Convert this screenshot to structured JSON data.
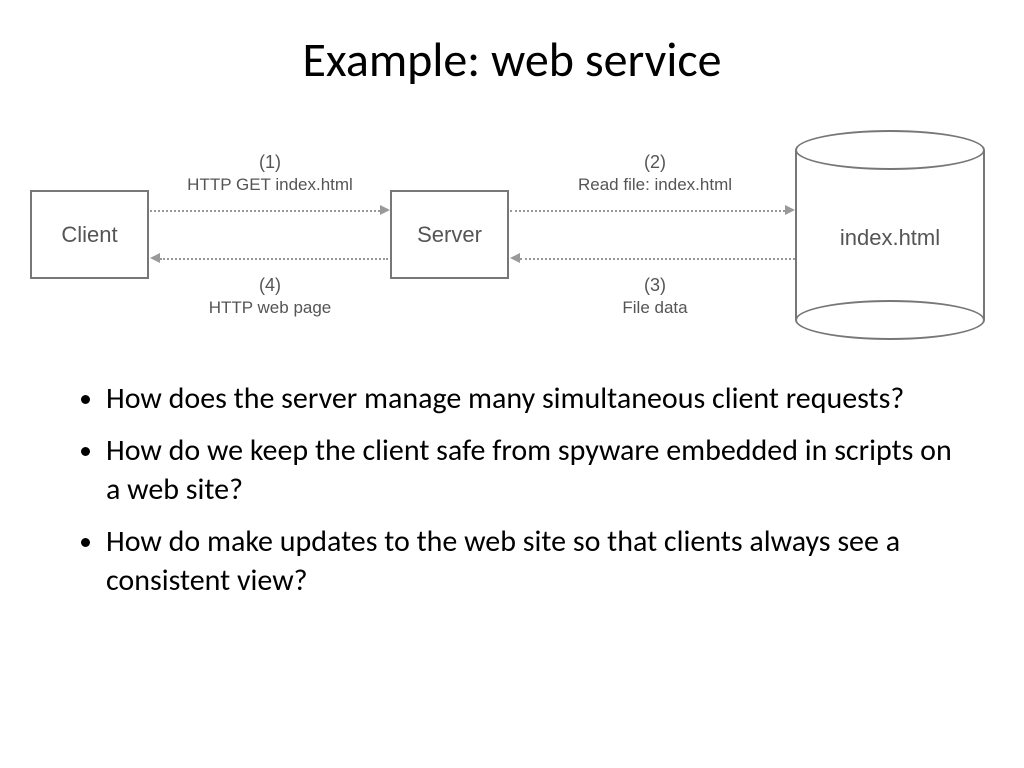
{
  "title": "Example: web service",
  "diagram": {
    "client_label": "Client",
    "server_label": "Server",
    "file_label": "index.html",
    "step1_num": "(1)",
    "step1_txt": "HTTP GET index.html",
    "step2_num": "(2)",
    "step2_txt": "Read file: index.html",
    "step3_num": "(3)",
    "step3_txt": "File data",
    "step4_num": "(4)",
    "step4_txt": "HTTP web page"
  },
  "bullets": [
    "How does the server manage many simultaneous client requests?",
    "How do we keep the client safe from spyware embedded in scripts on a web site?",
    "How do make updates to the web site so that clients always see a consistent view?"
  ]
}
